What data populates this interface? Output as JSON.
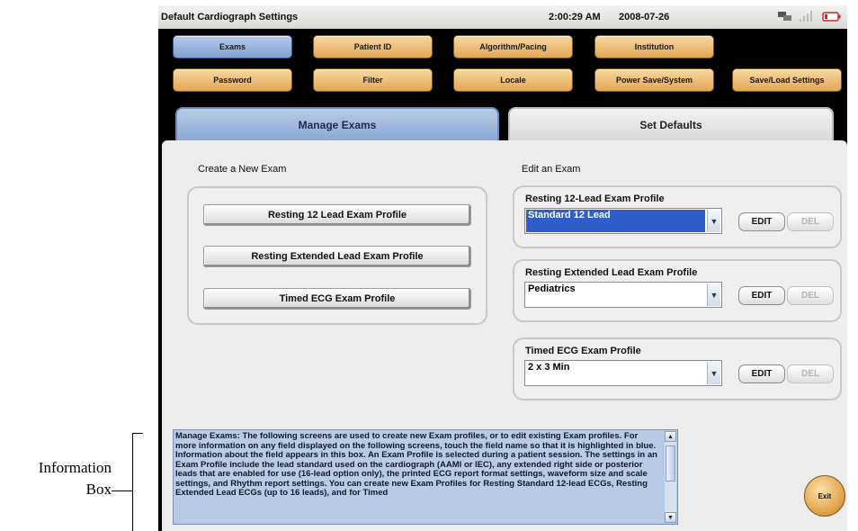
{
  "titlebar": {
    "title": "Default Cardiograph Settings",
    "time": "2:00:29 AM",
    "date": "2008-07-26",
    "icons": [
      "network-icon",
      "signal-icon",
      "battery-icon"
    ]
  },
  "nav": {
    "exams": "Exams",
    "patient_id": "Patient ID",
    "algorithm_pacing": "Algorithm/Pacing",
    "institution": "Institution",
    "password": "Password",
    "filter": "Filter",
    "locale": "Locale",
    "power_save": "Power Save/System",
    "save_load": "Save/Load Settings"
  },
  "tabs": {
    "manage": "Manage Exams",
    "defaults": "Set Defaults"
  },
  "create": {
    "heading": "Create a New Exam",
    "btn_12lead": "Resting 12 Lead Exam Profile",
    "btn_extended": "Resting Extended Lead Exam Profile",
    "btn_timed": "Timed ECG Exam Profile"
  },
  "edit": {
    "heading": "Edit an Exam",
    "groups": [
      {
        "label": "Resting 12-Lead Exam Profile",
        "value": "Standard 12 Lead",
        "edit": "EDIT",
        "del": "DEL"
      },
      {
        "label": "Resting Extended Lead Exam Profile",
        "value": "Pediatrics",
        "edit": "EDIT",
        "del": "DEL"
      },
      {
        "label": "Timed ECG Exam Profile",
        "value": "2 x 3 Min",
        "edit": "EDIT",
        "del": "DEL"
      }
    ]
  },
  "info": {
    "text": "Manage Exams: The following screens are used to create new Exam profiles, or to edit existing Exam profiles. For more information on any field displayed on the following screens, touch the field name so that it is highlighted in blue. Information about the field appears in this box. An Exam Profile is selected during a patient session. The settings in an Exam Profile include the lead standard used on the cardiograph (AAMI or IEC), any extended right side or posterior leads that are enabled for use (16-lead option only), the printed ECG report format settings, waveform size and scale settings, and Rhythm report settings. You can create new Exam Profiles for Resting Standard 12-lead ECGs, Resting Extended Lead ECGs (up to 16 leads), and for Timed"
  },
  "exit": "Exit",
  "callout": {
    "line1": "Information",
    "line2": "Box"
  },
  "colors": {
    "active_blue": "#8aa6d3",
    "nav_orange": "#e3a653",
    "selection_blue": "#2f5ecb",
    "info_bg": "#b7cbe6"
  }
}
